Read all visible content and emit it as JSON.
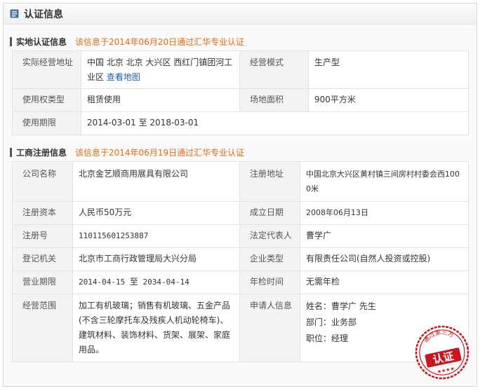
{
  "panel": {
    "title": "认证信息"
  },
  "site": {
    "title": "实地认证信息",
    "note": "该信息于2014年06月20日通过汇华专业认证",
    "address_label": "实际经营地址",
    "address_value": "中国 北京 北京 大兴区 西红门镇团河工业区",
    "map_link": "查看地图",
    "mode_label": "经营模式",
    "mode_value": "生产型",
    "right_label": "使用权类型",
    "right_value": "租赁使用",
    "area_label": "场地面积",
    "area_value": "900平方米",
    "period_label": "使用期限",
    "period_start": "2014-03-01",
    "period_sep": "至",
    "period_end": "2018-03-01"
  },
  "biz": {
    "title": "工商注册信息",
    "note": "该信息于2014年06月19日通过汇华专业认证",
    "company_label": "公司名称",
    "company_value": "北京金艺顺商用展具有限公司",
    "regaddr_label": "注册地址",
    "regaddr_value": "中国北京大兴区黄村镇三间房村村委会西1000米",
    "capital_label": "注册资本",
    "capital_value": "人民币50万元",
    "founded_label": "成立日期",
    "founded_value": "2008年06月13日",
    "regno_label": "注册号",
    "regno_value": "110115601253887",
    "legal_label": "法定代表人",
    "legal_value": "曹学广",
    "authority_label": "登记机关",
    "authority_value": "北京市工商行政管理局大兴分局",
    "type_label": "企业类型",
    "type_value": "有限责任公司(自然人投资或控股)",
    "term_label": "营业期限",
    "term_start": "2014-04-15",
    "term_sep": "至",
    "term_end": "2034-04-14",
    "check_label": "年检时间",
    "check_value": "无需年检",
    "scope_label": "经营范围",
    "scope_value": "加工有机玻璃；销售有机玻璃、五金产品(不含三轮摩托车及残疾人机动轮椅车)、建筑材料、装饰材料、货架、展架、家庭用品。",
    "applicant_label": "申请人信息",
    "applicant_name": "姓名：曹学广  先生",
    "applicant_dept": "部门：业务部",
    "applicant_position": "职位：经理"
  },
  "stamp": {
    "top_text": "通过第三方",
    "main_text": "认证"
  },
  "colors": {
    "accent": "#e06a12",
    "link": "#1a5fb4",
    "stamp": "#c8161d"
  }
}
